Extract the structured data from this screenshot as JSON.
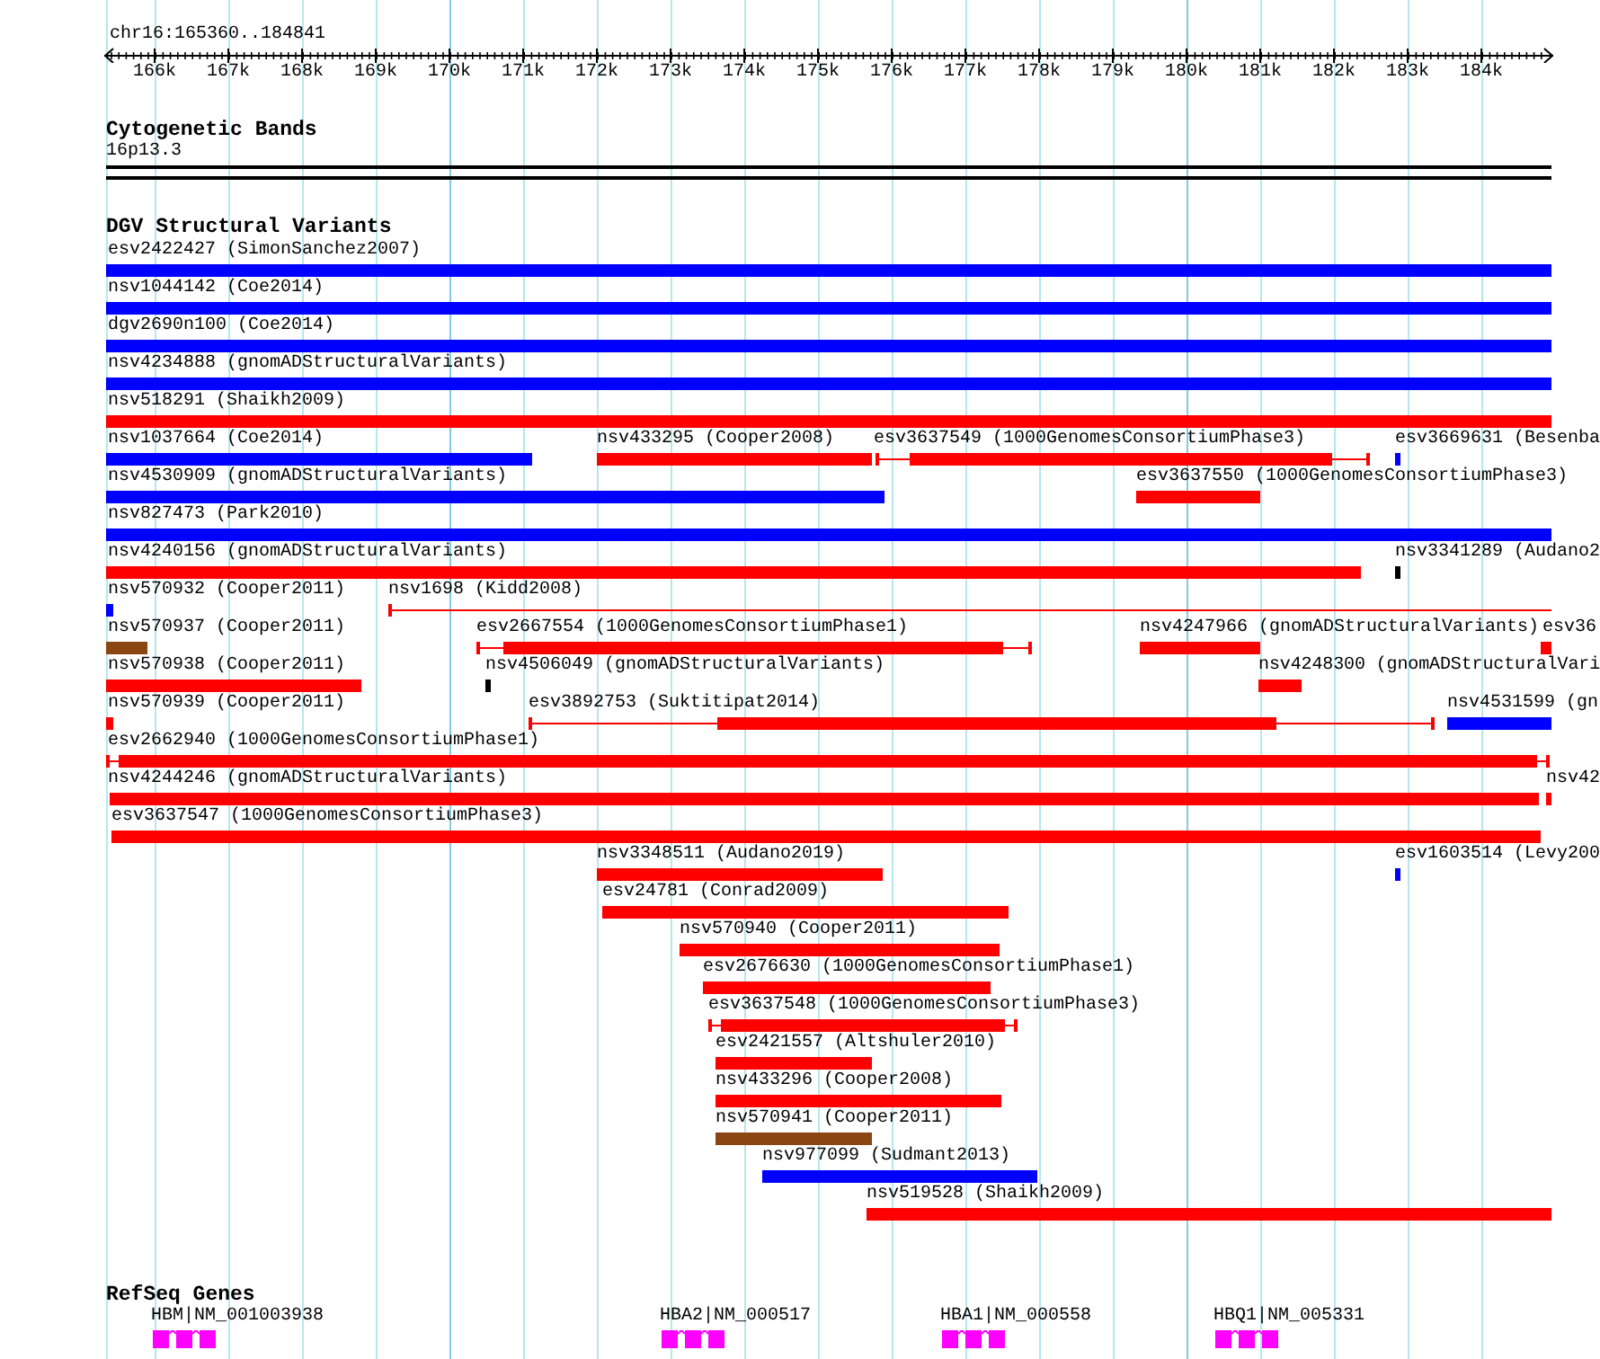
{
  "ruler": {
    "region": "chr16:165360..184841",
    "ticks": [
      "166k",
      "167k",
      "168k",
      "169k",
      "170k",
      "171k",
      "172k",
      "173k",
      "174k",
      "175k",
      "176k",
      "177k",
      "178k",
      "179k",
      "180k",
      "181k",
      "182k",
      "183k",
      "184k"
    ]
  },
  "cytogenetic_bands": {
    "title": "Cytogenetic Bands",
    "band": "16p13.3"
  },
  "dgv": {
    "title": "DGV Structural Variants",
    "rows": [
      {
        "features": [
          {
            "label": "esv2422427 (SimonSanchez2007)",
            "kind": "block",
            "color": "#0000ff"
          }
        ]
      },
      {
        "features": [
          {
            "label": "nsv1044142 (Coe2014)",
            "kind": "block",
            "color": "#0000ff"
          }
        ]
      },
      {
        "features": [
          {
            "label": "dgv2690n100 (Coe2014)",
            "kind": "block",
            "color": "#0000ff"
          }
        ]
      },
      {
        "features": [
          {
            "label": "nsv4234888 (gnomADStructuralVariants)",
            "kind": "block",
            "color": "#0000ff"
          }
        ]
      },
      {
        "features": [
          {
            "label": "nsv518291 (Shaikh2009)",
            "kind": "block",
            "color": "#ff0000"
          }
        ]
      },
      {
        "features": [
          {
            "label": "nsv1037664 (Coe2014)",
            "kind": "block",
            "color": "#0000ff"
          },
          {
            "label": "nsv433295 (Cooper2008)",
            "kind": "block",
            "color": "#ff0000"
          },
          {
            "label": "esv3637549 (1000GenomesConsortiumPhase3)",
            "kind": "whiskered",
            "color": "#ff0000"
          },
          {
            "label": "esv3669631 (Besenba",
            "kind": "block",
            "color": "#0000ff"
          }
        ]
      },
      {
        "features": [
          {
            "label": "nsv4530909 (gnomADStructuralVariants)",
            "kind": "block",
            "color": "#0000ff"
          },
          {
            "label": "esv3637550 (1000GenomesConsortiumPhase3)",
            "kind": "block",
            "color": "#ff0000"
          }
        ]
      },
      {
        "features": [
          {
            "label": "nsv827473 (Park2010)",
            "kind": "block",
            "color": "#0000ff"
          }
        ]
      },
      {
        "features": [
          {
            "label": "nsv4240156 (gnomADStructuralVariants)",
            "kind": "block",
            "color": "#ff0000"
          },
          {
            "label": "nsv3341289 (Audano2",
            "kind": "block",
            "color": "#000000"
          }
        ]
      },
      {
        "features": [
          {
            "label": "nsv570932 (Cooper2011)",
            "kind": "block",
            "color": "#0000ff"
          },
          {
            "label": "nsv1698 (Kidd2008)",
            "kind": "line",
            "color": "#ff0000"
          }
        ]
      },
      {
        "features": [
          {
            "label": "nsv570937 (Cooper2011)",
            "kind": "block",
            "color": "#8b4513"
          },
          {
            "label": "esv2667554 (1000GenomesConsortiumPhase1)",
            "kind": "whiskered",
            "color": "#ff0000"
          },
          {
            "label": "nsv4247966 (gnomADStructuralVariants)",
            "kind": "block",
            "color": "#ff0000"
          },
          {
            "label": "esv36",
            "kind": "block",
            "color": "#ff0000"
          }
        ]
      },
      {
        "features": [
          {
            "label": "nsv570938 (Cooper2011)",
            "kind": "block",
            "color": "#ff0000"
          },
          {
            "label": "nsv4506049 (gnomADStructuralVariants)",
            "kind": "block",
            "color": "#000000"
          },
          {
            "label": "nsv4248300 (gnomADStructuralVari",
            "kind": "block",
            "color": "#ff0000"
          }
        ]
      },
      {
        "features": [
          {
            "label": "nsv570939 (Cooper2011)",
            "kind": "block",
            "color": "#ff0000"
          },
          {
            "label": "esv3892753 (Suktitipat2014)",
            "kind": "whiskered",
            "color": "#ff0000"
          },
          {
            "label": "nsv4531599 (gn",
            "kind": "block",
            "color": "#0000ff"
          }
        ]
      },
      {
        "features": [
          {
            "label": "esv2662940 (1000GenomesConsortiumPhase1)",
            "kind": "whiskered",
            "color": "#ff0000"
          }
        ]
      },
      {
        "features": [
          {
            "label": "nsv4244246 (gnomADStructuralVariants)",
            "kind": "block",
            "color": "#ff0000"
          },
          {
            "label": "nsv42",
            "kind": "block",
            "color": "#ff0000"
          }
        ]
      },
      {
        "features": [
          {
            "label": "esv3637547 (1000GenomesConsortiumPhase3)",
            "kind": "block",
            "color": "#ff0000"
          }
        ]
      },
      {
        "features": [
          {
            "label": "nsv3348511 (Audano2019)",
            "kind": "block",
            "color": "#ff0000"
          },
          {
            "label": "esv1603514 (Levy200",
            "kind": "block",
            "color": "#0000ff"
          }
        ]
      },
      {
        "features": [
          {
            "label": "esv24781 (Conrad2009)",
            "kind": "block",
            "color": "#ff0000"
          }
        ]
      },
      {
        "features": [
          {
            "label": "nsv570940 (Cooper2011)",
            "kind": "block",
            "color": "#ff0000"
          }
        ]
      },
      {
        "features": [
          {
            "label": "esv2676630 (1000GenomesConsortiumPhase1)",
            "kind": "block",
            "color": "#ff0000"
          }
        ]
      },
      {
        "features": [
          {
            "label": "esv3637548 (1000GenomesConsortiumPhase3)",
            "kind": "whiskered",
            "color": "#ff0000"
          }
        ]
      },
      {
        "features": [
          {
            "label": "esv2421557 (Altshuler2010)",
            "kind": "block",
            "color": "#ff0000"
          }
        ]
      },
      {
        "features": [
          {
            "label": "nsv433296 (Cooper2008)",
            "kind": "block",
            "color": "#ff0000"
          }
        ]
      },
      {
        "features": [
          {
            "label": "nsv570941 (Cooper2011)",
            "kind": "block",
            "color": "#8b4513"
          }
        ]
      },
      {
        "features": [
          {
            "label": "nsv977099 (Sudmant2013)",
            "kind": "block",
            "color": "#0000ff"
          }
        ]
      },
      {
        "features": [
          {
            "label": "nsv519528 (Shaikh2009)",
            "kind": "block",
            "color": "#ff0000"
          }
        ]
      }
    ]
  },
  "refseq_genes": {
    "title": "RefSeq Genes",
    "genes": [
      {
        "label": "HBM|NM_001003938"
      },
      {
        "label": "HBA2|NM_000517"
      },
      {
        "label": "HBA1|NM_000558"
      },
      {
        "label": "HBQ1|NM_005331"
      }
    ]
  }
}
